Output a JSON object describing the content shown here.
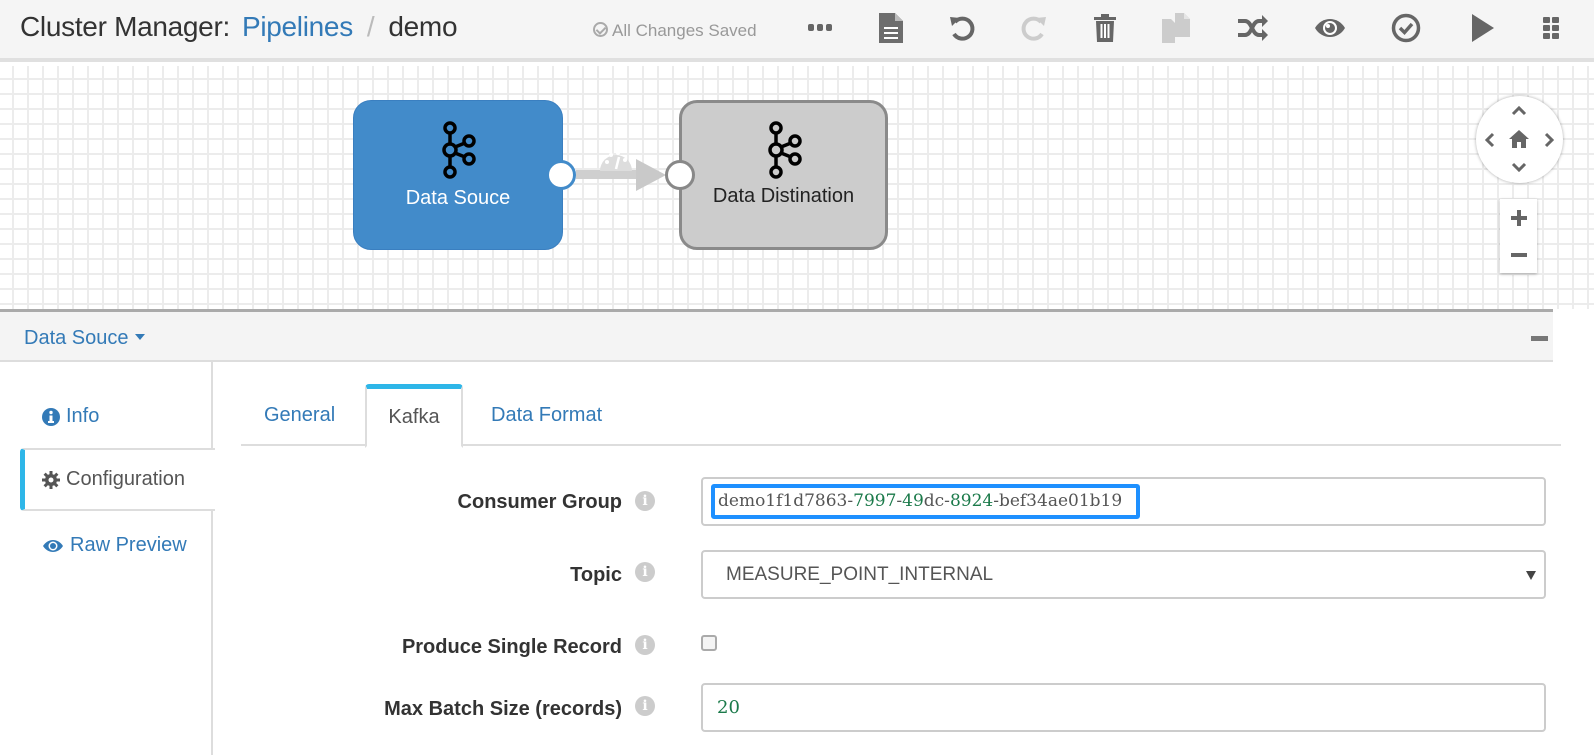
{
  "header": {
    "app_title": "Cluster Manager:",
    "breadcrumb_link": "Pipelines",
    "breadcrumb_separator": "/",
    "pipeline_name": "demo",
    "save_status": "All Changes Saved"
  },
  "toolbar": {
    "buttons": [
      {
        "name": "more-options",
        "icon": "ellipsis-icon",
        "enabled": true
      },
      {
        "name": "pipeline-config",
        "icon": "file-text-icon",
        "enabled": true
      },
      {
        "name": "undo",
        "icon": "undo-icon",
        "enabled": true
      },
      {
        "name": "redo",
        "icon": "redo-icon",
        "enabled": false
      },
      {
        "name": "delete",
        "icon": "trash-icon",
        "enabled": true
      },
      {
        "name": "duplicate",
        "icon": "copy-icon",
        "enabled": false
      },
      {
        "name": "auto-arrange",
        "icon": "shuffle-icon",
        "enabled": true
      },
      {
        "name": "preview",
        "icon": "eye-icon",
        "enabled": true
      },
      {
        "name": "validate",
        "icon": "check-circle-icon",
        "enabled": true
      },
      {
        "name": "start",
        "icon": "play-icon",
        "enabled": true
      },
      {
        "name": "stage-library",
        "icon": "grid-icon",
        "enabled": true
      }
    ]
  },
  "canvas": {
    "nodes": [
      {
        "label": "Data Souce",
        "icon": "kafka-icon",
        "selected": true
      },
      {
        "label": "Data Distination",
        "icon": "kafka-icon",
        "selected": false
      }
    ],
    "edge": {
      "from": "Data Souce",
      "to": "Data Distination",
      "icon": "gauge-icon"
    }
  },
  "detail": {
    "stage_selector": "Data Souce",
    "side_nav": [
      {
        "label": "Info",
        "icon": "info-circle-icon",
        "active": false
      },
      {
        "label": "Configuration",
        "icon": "gear-icon",
        "active": true
      },
      {
        "label": "Raw Preview",
        "icon": "eye-icon",
        "active": false
      }
    ],
    "tabs": [
      {
        "label": "General",
        "active": false
      },
      {
        "label": "Kafka",
        "active": true
      },
      {
        "label": "Data Format",
        "active": false
      }
    ],
    "fields": {
      "consumer_group": {
        "label": "Consumer Group",
        "value": "demo1f1d7863-7997-49dc-8924-bef34ae01b19",
        "segments": [
          {
            "text": "demo1f1d7863-",
            "numeric": false
          },
          {
            "text": "7997",
            "numeric": true
          },
          {
            "text": "-",
            "numeric": false
          },
          {
            "text": "49",
            "numeric": true
          },
          {
            "text": "dc-",
            "numeric": false
          },
          {
            "text": "8924",
            "numeric": true
          },
          {
            "text": "-bef34ae01b19",
            "numeric": false
          }
        ]
      },
      "topic": {
        "label": "Topic",
        "value": "MEASURE_POINT_INTERNAL"
      },
      "produce_single_record": {
        "label": "Produce Single Record",
        "checked": false
      },
      "max_batch_size": {
        "label": "Max Batch Size (records)",
        "value": "20"
      }
    }
  },
  "colors": {
    "accent_blue": "#337ab7",
    "node_selected": "#428bca",
    "node_default": "#cccccc",
    "active_indicator": "#2eb6e8",
    "focus_border": "#1e90ff",
    "numeric_text": "#1b7a4a"
  }
}
